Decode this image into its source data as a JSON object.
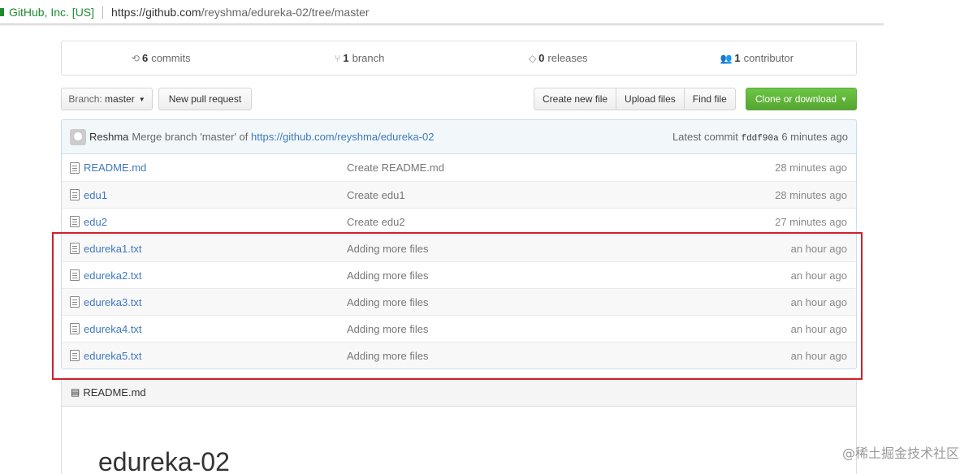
{
  "address_bar": {
    "cert_label": "GitHub, Inc. [US]",
    "url_host": "https://github.com",
    "url_path": "/reyshma/edureka-02/tree/master"
  },
  "summary": {
    "commits_count": "6",
    "commits_label": "commits",
    "branch_count": "1",
    "branch_label": "branch",
    "releases_count": "0",
    "releases_label": "releases",
    "contributor_count": "1",
    "contributor_label": "contributor"
  },
  "toolbar": {
    "branch_prefix": "Branch:",
    "branch_name": "master",
    "new_pr": "New pull request",
    "create_file": "Create new file",
    "upload_files": "Upload files",
    "find_file": "Find file",
    "clone": "Clone or download"
  },
  "commit_tease": {
    "author": "Reshma",
    "message": "Merge branch 'master' of",
    "message_link": "https://github.com/reyshma/edureka-02",
    "latest_label": "Latest commit",
    "sha": "fddf90a",
    "age": "6 minutes ago"
  },
  "files": [
    {
      "name": "README.md",
      "message": "Create README.md",
      "age": "28 minutes ago"
    },
    {
      "name": "edu1",
      "message": "Create edu1",
      "age": "28 minutes ago"
    },
    {
      "name": "edu2",
      "message": "Create edu2",
      "age": "27 minutes ago"
    },
    {
      "name": "edureka1.txt",
      "message": "Adding more files",
      "age": "an hour ago"
    },
    {
      "name": "edureka2.txt",
      "message": "Adding more files",
      "age": "an hour ago"
    },
    {
      "name": "edureka3.txt",
      "message": "Adding more files",
      "age": "an hour ago"
    },
    {
      "name": "edureka4.txt",
      "message": "Adding more files",
      "age": "an hour ago"
    },
    {
      "name": "edureka5.txt",
      "message": "Adding more files",
      "age": "an hour ago"
    }
  ],
  "readme": {
    "header": "README.md",
    "title": "edureka-02"
  },
  "watermark": "@稀土掘金技术社区",
  "colors": {
    "link": "#4078c0",
    "clone_green": "#6cc644",
    "highlight_red": "#d0202a",
    "cert_green": "#1f8c2f"
  }
}
